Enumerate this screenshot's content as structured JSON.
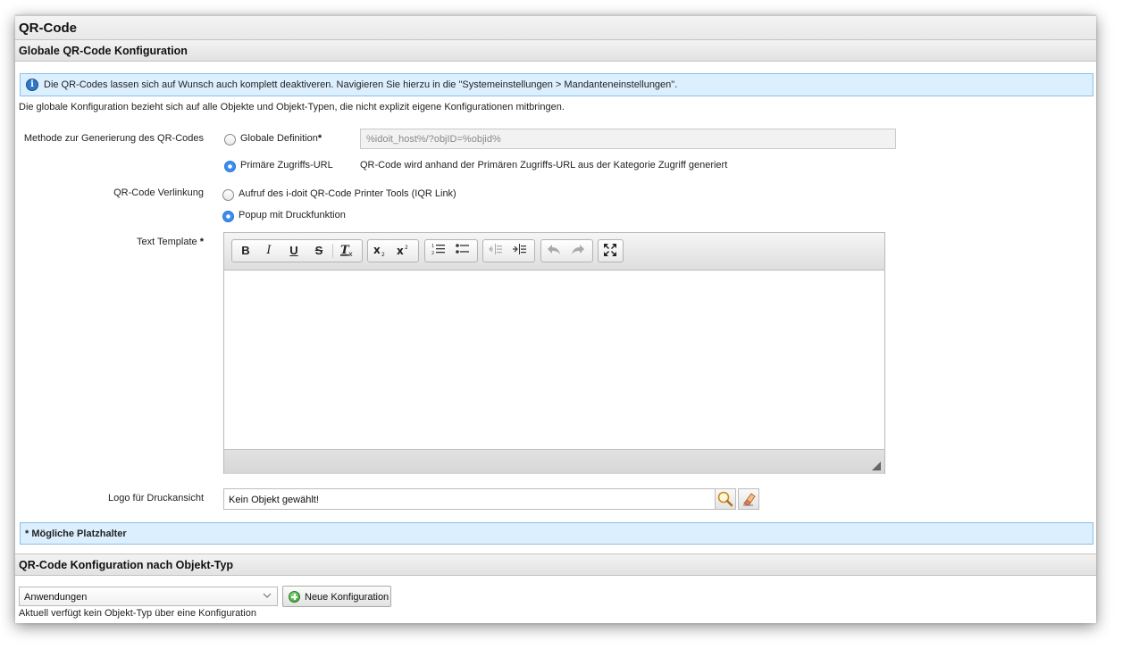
{
  "page": {
    "title": "QR-Code"
  },
  "global_section": {
    "title": "Globale QR-Code Konfiguration",
    "info_text": "Die QR-Codes lassen sich auf Wunsch auch komplett deaktiveren. Navigieren Sie hierzu in die \"Systemeinstellungen > Mandanteneinstellungen\".",
    "description": "Die globale Konfiguration bezieht sich auf alle Objekte und Objekt-Typen, die nicht explizit eigene Konfigurationen mitbringen."
  },
  "method": {
    "label": "Methode zur Generierung des QR-Codes",
    "option_global_label": "Globale Definition",
    "required_mark": "*",
    "global_definition_value": "%idoit_host%/?objID=%objid%",
    "option_primary_label": "Primäre Zugriffs-URL",
    "primary_hint": "QR-Code wird anhand der Primären Zugriffs-URL aus der Kategorie Zugriff generiert",
    "selected": "primary"
  },
  "linking": {
    "label": "QR-Code Verlinkung",
    "option_iqr_label": "Aufruf des i-doit QR-Code Printer Tools (IQR Link)",
    "option_popup_label": "Popup mit Druckfunktion",
    "selected": "popup"
  },
  "text_template": {
    "label": "Text Template",
    "required_mark": "*",
    "content": ""
  },
  "editor_toolbar": {
    "bold": "B",
    "italic": "I",
    "underline": "U",
    "strike": "S"
  },
  "logo": {
    "label": "Logo für Druckansicht",
    "value": "Kein Objekt gewählt!"
  },
  "placeholders": {
    "title": "* Mögliche Platzhalter"
  },
  "per_type_section": {
    "title": "QR-Code Konfiguration nach Objekt-Typ",
    "select_value": "Anwendungen",
    "new_config_label": "Neue Konfiguration",
    "status_text": "Aktuell verfügt kein Objekt-Typ über eine Konfiguration"
  }
}
